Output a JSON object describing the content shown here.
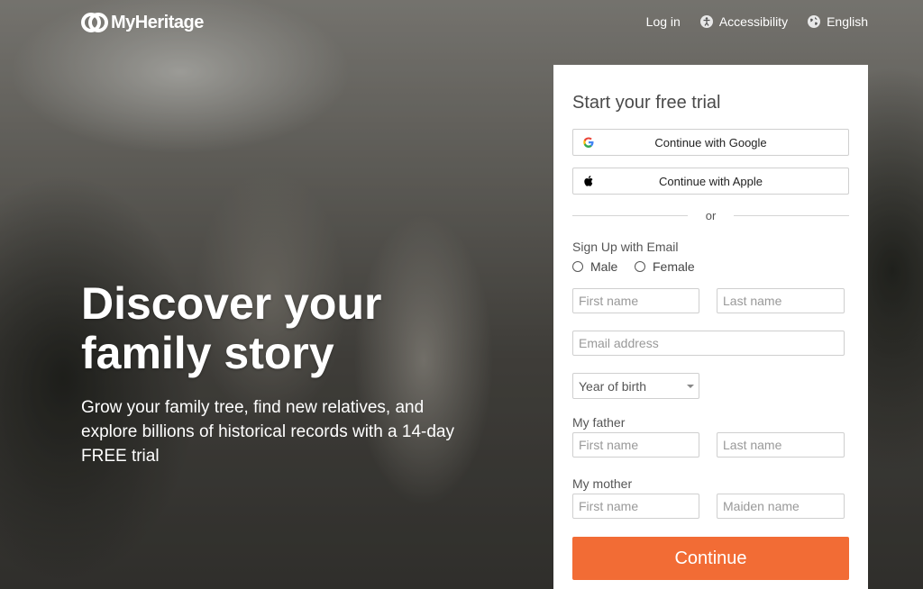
{
  "brand": {
    "name": "MyHeritage",
    "logo_icon": "myheritage-logo-icon"
  },
  "nav": {
    "login": "Log in",
    "accessibility": "Accessibility",
    "language": "English"
  },
  "hero": {
    "headline": "Discover your family story",
    "subtext": "Grow your family tree, find new relatives, and explore billions of historical records with a 14-day FREE trial"
  },
  "signup": {
    "title": "Start your free trial",
    "google": "Continue with Google",
    "apple": "Continue with Apple",
    "or": "or",
    "email_section": "Sign Up with Email",
    "gender": {
      "male": "Male",
      "female": "Female"
    },
    "first_name_placeholder": "First name",
    "last_name_placeholder": "Last name",
    "email_placeholder": "Email address",
    "year_of_birth": "Year of birth",
    "father_label": "My father",
    "father_first": "First name",
    "father_last": "Last name",
    "mother_label": "My mother",
    "mother_first": "First name",
    "mother_maiden": "Maiden name",
    "continue": "Continue"
  },
  "colors": {
    "accent": "#f26c35",
    "text_dark": "#4a4a4a"
  }
}
